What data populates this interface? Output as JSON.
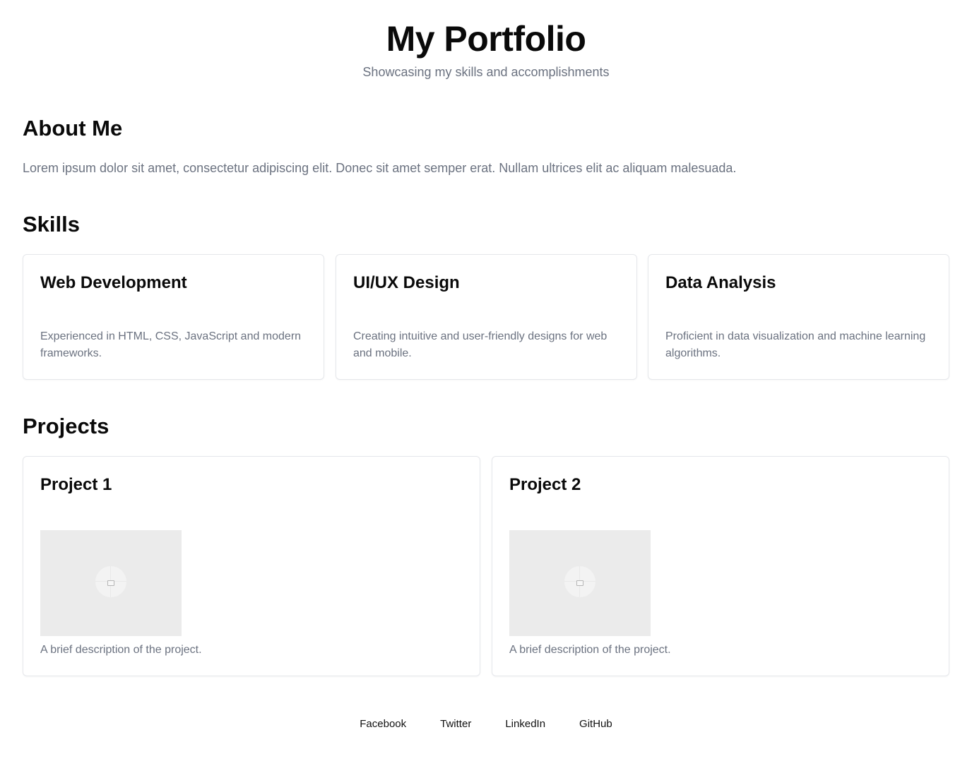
{
  "header": {
    "title": "My Portfolio",
    "subtitle": "Showcasing my skills and accomplishments"
  },
  "about": {
    "title": "About Me",
    "text": "Lorem ipsum dolor sit amet, consectetur adipiscing elit. Donec sit amet semper erat. Nullam ultrices elit ac aliquam malesuada."
  },
  "skills": {
    "title": "Skills",
    "items": [
      {
        "title": "Web Development",
        "description": "Experienced in HTML, CSS, JavaScript and modern frameworks."
      },
      {
        "title": "UI/UX Design",
        "description": "Creating intuitive and user-friendly designs for web and mobile."
      },
      {
        "title": "Data Analysis",
        "description": "Proficient in data visualization and machine learning algorithms."
      }
    ]
  },
  "projects": {
    "title": "Projects",
    "items": [
      {
        "title": "Project 1",
        "image_icon": "image-placeholder-icon",
        "description": "A brief description of the project."
      },
      {
        "title": "Project 2",
        "image_icon": "image-placeholder-icon",
        "description": "A brief description of the project."
      }
    ]
  },
  "footer": {
    "links": [
      "Facebook",
      "Twitter",
      "LinkedIn",
      "GitHub"
    ]
  },
  "colors": {
    "text": "#0a0a0a",
    "muted": "#6b7280",
    "border": "#e5e7eb",
    "placeholder": "#ebebeb"
  }
}
